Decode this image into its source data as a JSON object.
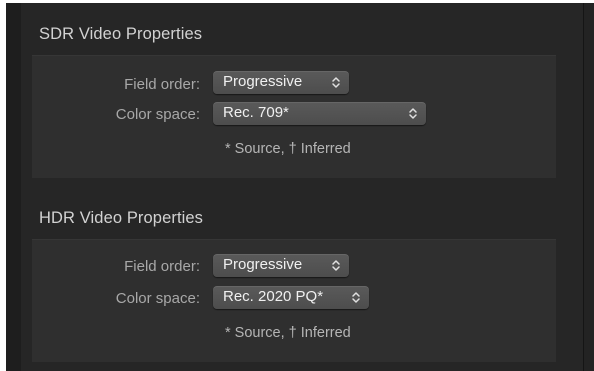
{
  "sdr": {
    "title": "SDR Video Properties",
    "field_order_label": "Field order:",
    "field_order_value": "Progressive",
    "color_space_label": "Color space:",
    "color_space_value": "Rec. 709*",
    "footnote": "* Source, † Inferred"
  },
  "hdr": {
    "title": "HDR Video Properties",
    "field_order_label": "Field order:",
    "field_order_value": "Progressive",
    "color_space_label": "Color space:",
    "color_space_value": "Rec. 2020 PQ*",
    "footnote": "* Source, † Inferred"
  },
  "icons": {
    "popup_arrows": "up-down-chevron-icon"
  },
  "colors": {
    "background": "#262626",
    "panel": "#2f2f2f",
    "popup": "#555555",
    "title_text": "#d2d2d2",
    "label_text": "#a8a8a8"
  }
}
